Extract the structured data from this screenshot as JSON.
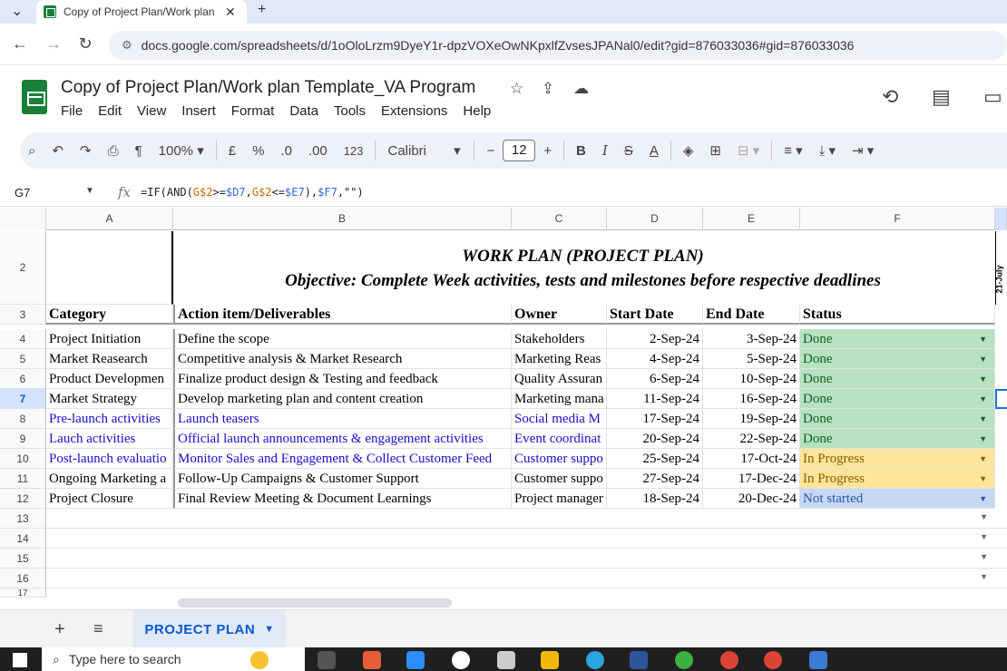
{
  "browser": {
    "tab_title": "Copy of Project Plan/Work plan",
    "url": "docs.google.com/spreadsheets/d/1oOloLrzm9DyeY1r-dpzVOXeOwNKpxlfZvsesJPANal0/edit?gid=876033036#gid=876033036"
  },
  "doc": {
    "title": "Copy of Project Plan/Work plan Template_VA Program",
    "menu": [
      "File",
      "Edit",
      "View",
      "Insert",
      "Format",
      "Data",
      "Tools",
      "Extensions",
      "Help"
    ]
  },
  "toolbar": {
    "zoom": "100%",
    "currency": "£",
    "percent": "%",
    "dec_less": ".0",
    "dec_more": ".00",
    "num_format": "123",
    "font": "Calibri",
    "font_size": "12",
    "bold": "B",
    "italic": "I",
    "underline_a": "A"
  },
  "formula": {
    "cell": "G7",
    "fx": "fx",
    "p1": "=IF(AND(",
    "r1": "G$2",
    "p2": ">=",
    "r2": "$D7",
    "p3": ",",
    "r3": "G$2",
    "p4": "<=",
    "r4": "$E7",
    "p5": "),",
    "r5": "$F7",
    "p6": ",\"\")"
  },
  "columns": [
    "A",
    "B",
    "C",
    "D",
    "E",
    "F"
  ],
  "banner": {
    "line1": "WORK PLAN (PROJECT PLAN)",
    "line2": "Objective: Complete Week  activities, tests and milestones before respective deadlines"
  },
  "header_row": {
    "num": "3",
    "category": "Category",
    "action": "Action item/Deliverables",
    "owner": "Owner",
    "start": "Start Date",
    "end": "End Date",
    "status": "Status"
  },
  "rows": [
    {
      "num": "4",
      "category": "Project Initiation",
      "action": " Define the scope",
      "owner": "Stakeholders",
      "start": "2-Sep-24",
      "end": "3-Sep-24",
      "status": "Done"
    },
    {
      "num": "5",
      "category": "Market Reasearch",
      "action": "Competitive analysis & Market Research",
      "owner": "Marketing Reas",
      "start": "4-Sep-24",
      "end": "5-Sep-24",
      "status": "Done"
    },
    {
      "num": "6",
      "category": "Product Developmen",
      "action": "Finalize product design & Testing and feedback",
      "owner": "Quality Assuran",
      "start": "6-Sep-24",
      "end": "10-Sep-24",
      "status": "Done"
    },
    {
      "num": "7",
      "category": "Market Strategy",
      "action": "Develop marketing plan  and content creation",
      "owner": "Marketing mana",
      "start": "11-Sep-24",
      "end": "16-Sep-24",
      "status": "Done"
    },
    {
      "num": "8",
      "category": "Pre-launch activities",
      "action": "Launch teasers",
      "owner": "Social media M",
      "start": "17-Sep-24",
      "end": "19-Sep-24",
      "status": "Done"
    },
    {
      "num": "9",
      "category": "Lauch activities",
      "action": "Official launch announcements & engagement activities",
      "owner": "Event coordinat",
      "start": "20-Sep-24",
      "end": "22-Sep-24",
      "status": "Done"
    },
    {
      "num": "10",
      "category": "Post-launch evaluatio",
      "action": "Monitor Sales and Engagement & Collect Customer Feed",
      "owner": "Customer suppo",
      "start": "25-Sep-24",
      "end": "17-Oct-24",
      "status": "In Progress"
    },
    {
      "num": "11",
      "category": "Ongoing Marketing a",
      "action": "Follow-Up Campaigns & Customer Support",
      "owner": "Customer suppo",
      "start": "27-Sep-24",
      "end": "17-Dec-24",
      "status": "In Progress"
    },
    {
      "num": "12",
      "category": "Project Closure",
      "action": "Final Review Meeting & Document Learnings",
      "owner": "Project manager",
      "start": "18-Sep-24",
      "end": "20-Dec-24",
      "status": "Not started"
    }
  ],
  "empty_rows": [
    "13",
    "14",
    "15",
    "16",
    "17"
  ],
  "row2_label": "2",
  "side_header": "21-July",
  "sheet": {
    "tab": "PROJECT PLAN"
  },
  "taskbar": {
    "search": "Type here to search"
  }
}
